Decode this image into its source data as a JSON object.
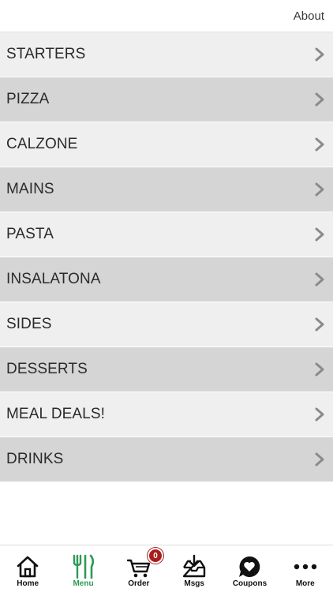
{
  "header": {
    "about_label": "About"
  },
  "menu": {
    "items": [
      {
        "label": "STARTERS",
        "shade": "light"
      },
      {
        "label": "PIZZA",
        "shade": "dark"
      },
      {
        "label": "CALZONE",
        "shade": "light"
      },
      {
        "label": "MAINS",
        "shade": "dark"
      },
      {
        "label": "PASTA",
        "shade": "light"
      },
      {
        "label": "INSALATONA",
        "shade": "dark"
      },
      {
        "label": "SIDES",
        "shade": "light"
      },
      {
        "label": "DESSERTS",
        "shade": "dark"
      },
      {
        "label": "MEAL DEALS!",
        "shade": "light"
      },
      {
        "label": "DRINKS",
        "shade": "dark"
      }
    ],
    "chevron_icon": "chevron-right-icon"
  },
  "tabbar": {
    "active_tab": "Menu",
    "accent_color": "#2e9a55",
    "badge_color": "#a81d1d",
    "tabs": [
      {
        "label": "Home",
        "icon": "home-icon"
      },
      {
        "label": "Menu",
        "icon": "fork-knife-icon"
      },
      {
        "label": "Order",
        "icon": "cart-icon",
        "badge": "0"
      },
      {
        "label": "Msgs",
        "icon": "inbox-icon"
      },
      {
        "label": "Coupons",
        "icon": "heart-bubble-icon"
      },
      {
        "label": "More",
        "icon": "more-dots-icon"
      }
    ]
  }
}
